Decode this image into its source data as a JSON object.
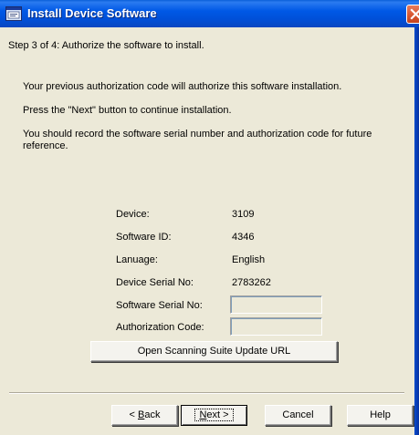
{
  "window": {
    "title": "Install Device Software"
  },
  "icons": {
    "app": "app-window-icon",
    "close": "close-icon"
  },
  "step": {
    "text": "Step 3 of 4:  Authorize the software to install."
  },
  "messages": [
    "Your previous authorization code will authorize this software installation.",
    "Press the \"Next\" button to continue installation.",
    "You should record the software serial number and authorization code for future reference."
  ],
  "info": {
    "device_label": "Device:",
    "device_value": "3109",
    "software_id_label": "Software ID:",
    "software_id_value": "4346",
    "language_label": "Lanuage:",
    "language_value": "English",
    "device_serial_label": "Device Serial No:",
    "device_serial_value": "2783262",
    "software_serial_label": "Software Serial No:",
    "software_serial_value": "",
    "auth_code_label": "Authorization Code:",
    "auth_code_value": ""
  },
  "buttons": {
    "open_url": "Open Scanning Suite Update URL",
    "back_prefix": "< ",
    "back_mnemonic": "B",
    "back_rest": "ack",
    "next_mnemonic": "N",
    "next_rest": "ext >",
    "cancel": "Cancel",
    "help": "Help"
  },
  "colors": {
    "titlebar": "#0058e6",
    "window_bg": "#ece9d8",
    "close_button": "#d6552e"
  }
}
